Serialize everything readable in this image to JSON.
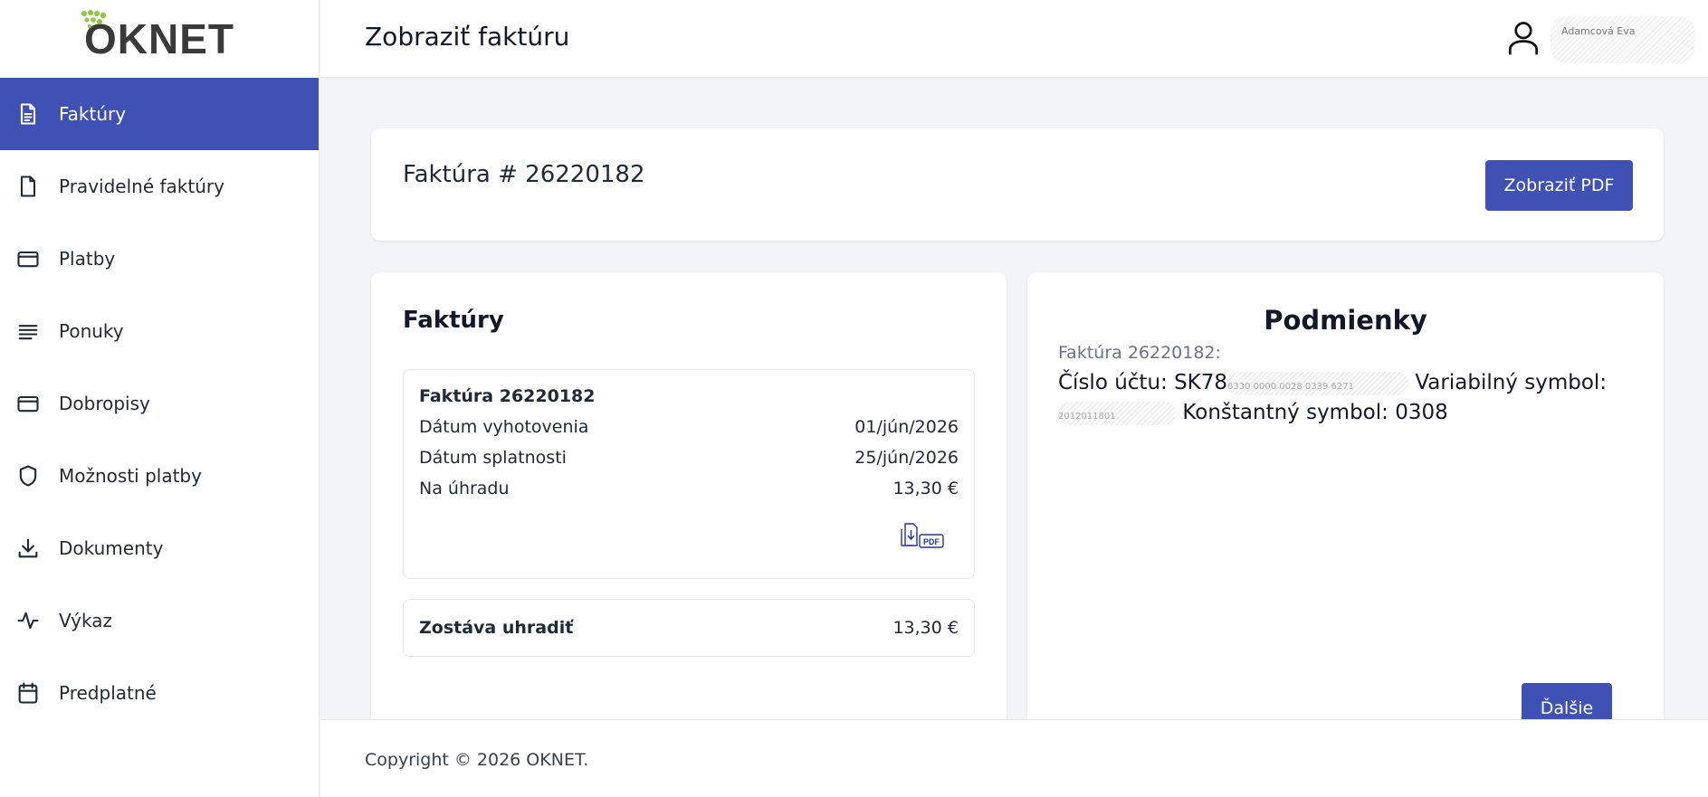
{
  "brand": {
    "logo_text": "OKNET",
    "accent": "#3f51b5",
    "logo_dots_color": "#8dc63f"
  },
  "header": {
    "title": "Zobraziť faktúru",
    "user_icon": "user-icon",
    "user_name": "Adamcová Eva"
  },
  "sidebar": {
    "items": [
      {
        "label": "Faktúry",
        "icon": "invoice-icon",
        "active": true
      },
      {
        "label": "Pravidelné faktúry",
        "icon": "document-icon",
        "active": false
      },
      {
        "label": "Platby",
        "icon": "card-icon",
        "active": false
      },
      {
        "label": "Ponuky",
        "icon": "lines-icon",
        "active": false
      },
      {
        "label": "Dobropisy",
        "icon": "card-icon",
        "active": false
      },
      {
        "label": "Možnosti platby",
        "icon": "shield-icon",
        "active": false
      },
      {
        "label": "Dokumenty",
        "icon": "download-icon",
        "active": false
      },
      {
        "label": "Výkaz",
        "icon": "activity-icon",
        "active": false
      },
      {
        "label": "Predplatné",
        "icon": "calendar-icon",
        "active": false
      }
    ]
  },
  "invoice_header": {
    "number_label": "Faktúra # 26220182",
    "pdf_button": "Zobraziť PDF"
  },
  "invoices_card": {
    "title": "Faktúry",
    "invoice": {
      "title": "Faktúra 26220182",
      "rows": [
        {
          "label": "Dátum vyhotovenia",
          "value": "01/jún/2026"
        },
        {
          "label": "Dátum splatnosti",
          "value": "25/jún/2026"
        },
        {
          "label": "Na úhradu",
          "value": "13,30 €"
        }
      ],
      "pdf_icon": "pdf-download-icon",
      "pdf_icon_text": "PDF"
    },
    "remaining": {
      "label": "Zostáva uhradiť",
      "value": "13,30 €"
    }
  },
  "conditions_card": {
    "title": "Podmienky",
    "subtitle": "Faktúra 26220182:",
    "account_label": "Číslo účtu: SK78",
    "account_redacted": "8330 0000 0028 0339 6271",
    "variable_label": "Variabilný symbol:",
    "variable_redacted": "2012011801",
    "constant_label": "Konštantný symbol: 0308",
    "next_button": "Ďalšie"
  },
  "footer": {
    "copyright": "Copyright © 2026 OKNET."
  }
}
